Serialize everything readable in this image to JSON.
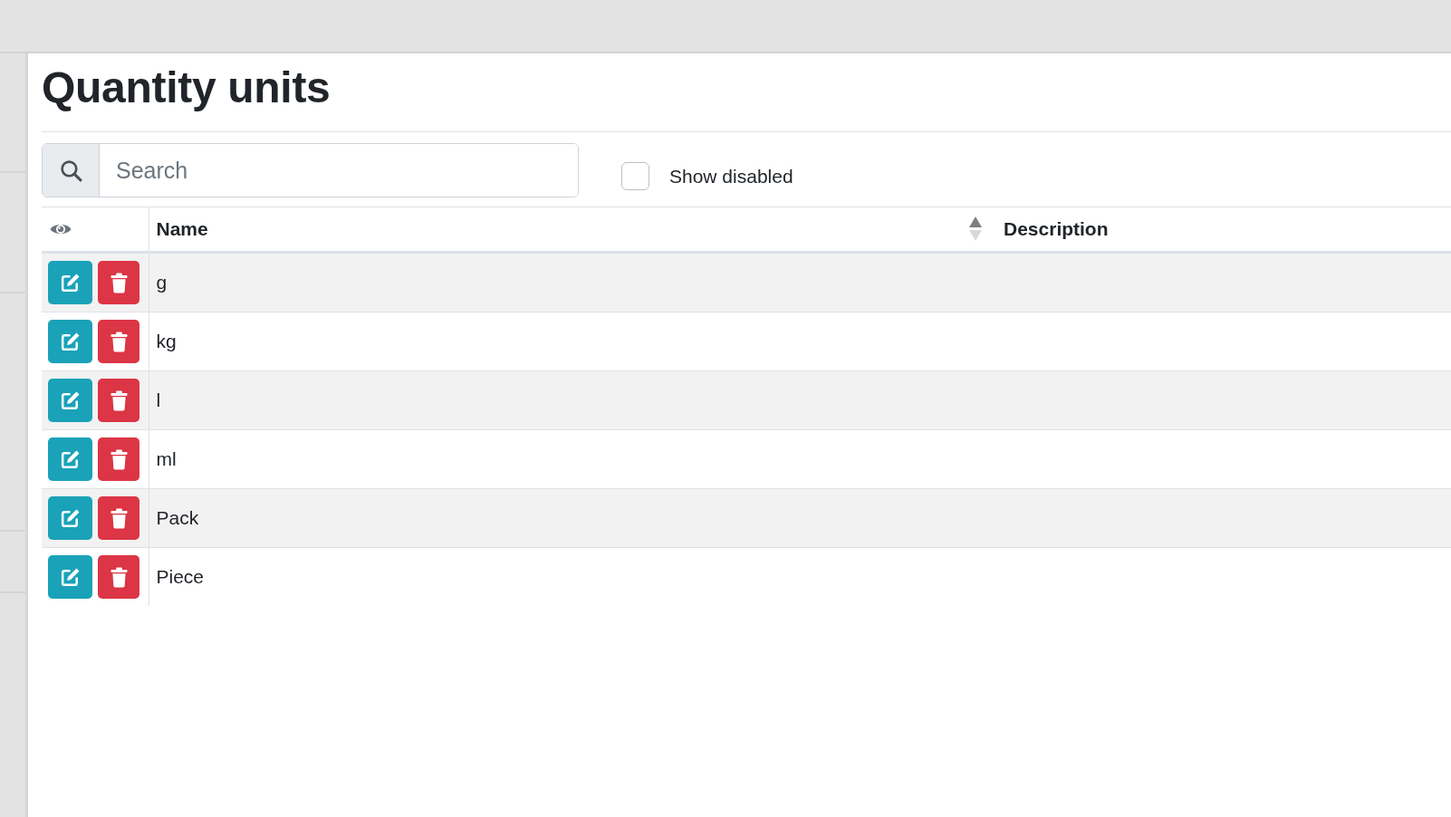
{
  "page": {
    "title": "Quantity units"
  },
  "search": {
    "placeholder": "Search"
  },
  "show_disabled": {
    "label": "Show disabled",
    "checked": false
  },
  "table": {
    "columns": [
      {
        "label": "Name",
        "sorted": true
      },
      {
        "label": "Description",
        "sorted": false
      }
    ],
    "rows": [
      {
        "name": "g"
      },
      {
        "name": "kg"
      },
      {
        "name": "l"
      },
      {
        "name": "ml"
      },
      {
        "name": "Pack"
      },
      {
        "name": "Piece"
      }
    ]
  }
}
